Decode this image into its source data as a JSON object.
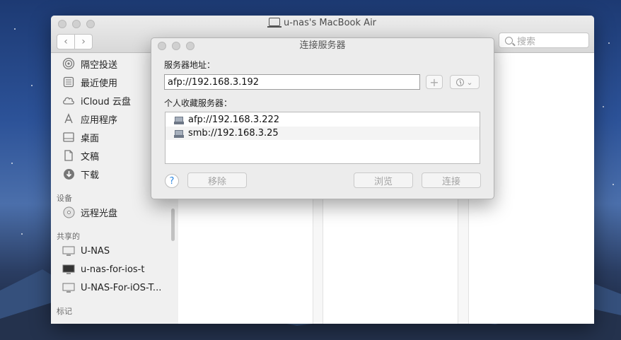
{
  "finder": {
    "title": "u-nas's MacBook Air",
    "back_icon": "‹",
    "forward_icon": "›",
    "search_placeholder": "搜索"
  },
  "sidebar": {
    "favorites": [
      {
        "label": "隔空投送",
        "icon": "airdrop-icon"
      },
      {
        "label": "最近使用",
        "icon": "recents-icon"
      },
      {
        "label": "iCloud 云盘",
        "icon": "cloud-icon"
      },
      {
        "label": "应用程序",
        "icon": "applications-icon"
      },
      {
        "label": "桌面",
        "icon": "desktop-icon"
      },
      {
        "label": "文稿",
        "icon": "documents-icon"
      },
      {
        "label": "下载",
        "icon": "downloads-icon"
      }
    ],
    "devices_header": "设备",
    "devices": [
      {
        "label": "远程光盘",
        "icon": "disc-icon"
      }
    ],
    "shared_header": "共享的",
    "shared": [
      {
        "label": "U-NAS",
        "icon": "display-icon"
      },
      {
        "label": "u-nas-for-ios-t",
        "icon": "display-icon"
      },
      {
        "label": "U-NAS-For-iOS-T...",
        "icon": "display-icon"
      }
    ],
    "tags_header": "标记"
  },
  "dialog": {
    "title": "连接服务器",
    "address_label": "服务器地址：",
    "address_value": "afp://192.168.3.192",
    "plus_label": "+",
    "favorites_label": "个人收藏服务器：",
    "favorites": [
      "afp://192.168.3.222",
      "smb://192.168.3.25"
    ],
    "help_label": "?",
    "remove_label": "移除",
    "browse_label": "浏览",
    "connect_label": "连接"
  }
}
